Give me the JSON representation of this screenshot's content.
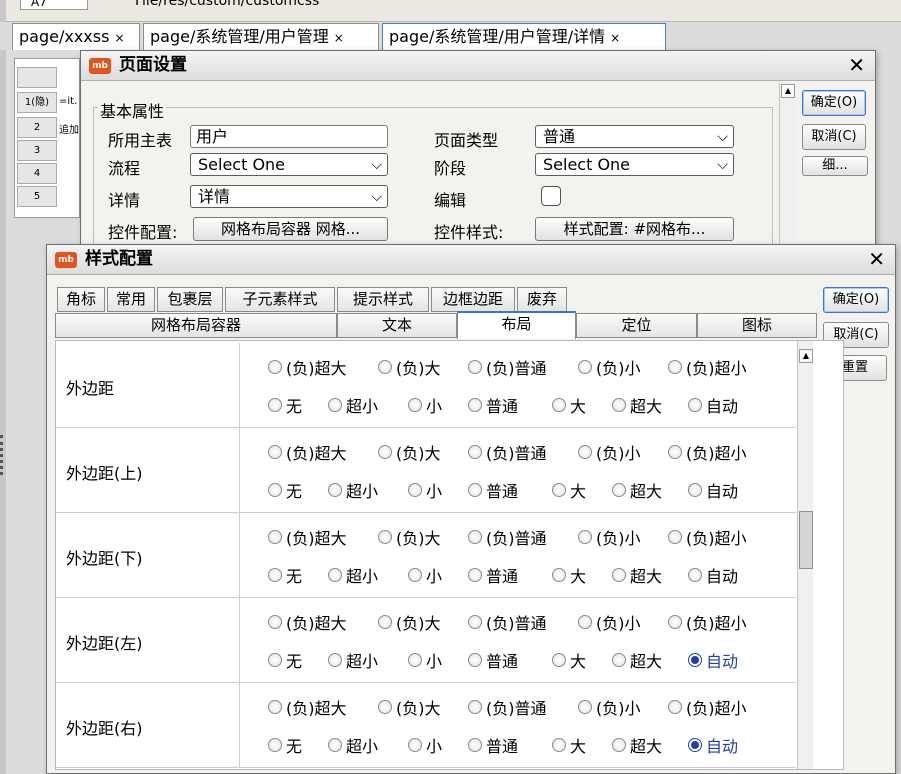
{
  "top": {
    "cell_ref": "A7",
    "path": "File/res/custom/customcss"
  },
  "tabs": [
    {
      "label": "page/xxxss"
    },
    {
      "label": "page/系统管理/用户管理"
    },
    {
      "label": "page/系统管理/用户管理/详情"
    }
  ],
  "tab_close_glyph": "×",
  "sheet": {
    "rows": [
      {
        "header": "1(隐)",
        "text": "=it."
      },
      {
        "header": "2",
        "text": "追加"
      },
      {
        "header": "3",
        "text": ""
      },
      {
        "header": "4",
        "text": ""
      },
      {
        "header": "5",
        "text": ""
      }
    ]
  },
  "page_dialog": {
    "logo": "mb",
    "title": "页面设置",
    "buttons": {
      "ok": "确定(O)",
      "cancel": "取消(C)",
      "detail": "细..."
    },
    "group_title": "基本属性",
    "fields": {
      "main_table_label": "所用主表",
      "main_table_value": "用户",
      "page_type_label": "页面类型",
      "page_type_value": "普通",
      "flow_label": "流程",
      "flow_value": "Select One",
      "stage_label": "阶段",
      "stage_value": "Select One",
      "detail_label": "详情",
      "detail_value": "详情",
      "edit_label": "编辑",
      "control_config_label": "控件配置:",
      "control_config_button": "网格布局容器  网格...",
      "control_style_label": "控件样式:",
      "control_style_button": "样式配置: #网格布..."
    }
  },
  "style_dialog": {
    "logo": "mb",
    "title": "样式配置",
    "buttons": {
      "ok": "确定(O)",
      "cancel": "取消(C)",
      "reset": "重置"
    },
    "tabs_row1": [
      "角标",
      "常用",
      "包裹层",
      "子元素样式",
      "提示样式",
      "边框边距",
      "废弃"
    ],
    "tabs_row2": [
      "网格布局容器",
      "文本",
      "布局",
      "定位",
      "图标"
    ],
    "active_tab2": "布局",
    "properties": [
      {
        "label": "外边距",
        "selected": ""
      },
      {
        "label": "外边距(上)",
        "selected": ""
      },
      {
        "label": "外边距(下)",
        "selected": ""
      },
      {
        "label": "外边距(左)",
        "selected": "自动"
      },
      {
        "label": "外边距(右)",
        "selected": "自动"
      }
    ],
    "options_row1": [
      "(负)超大",
      "(负)大",
      "(负)普通",
      "(负)小",
      "(负)超小"
    ],
    "options_row2": [
      "无",
      "超小",
      "小",
      "普通",
      "大",
      "超大",
      "自动"
    ]
  },
  "icons": {
    "close": "close-icon",
    "chevron": "chevron-down-icon",
    "scroll_up": "arrow-up-icon"
  }
}
